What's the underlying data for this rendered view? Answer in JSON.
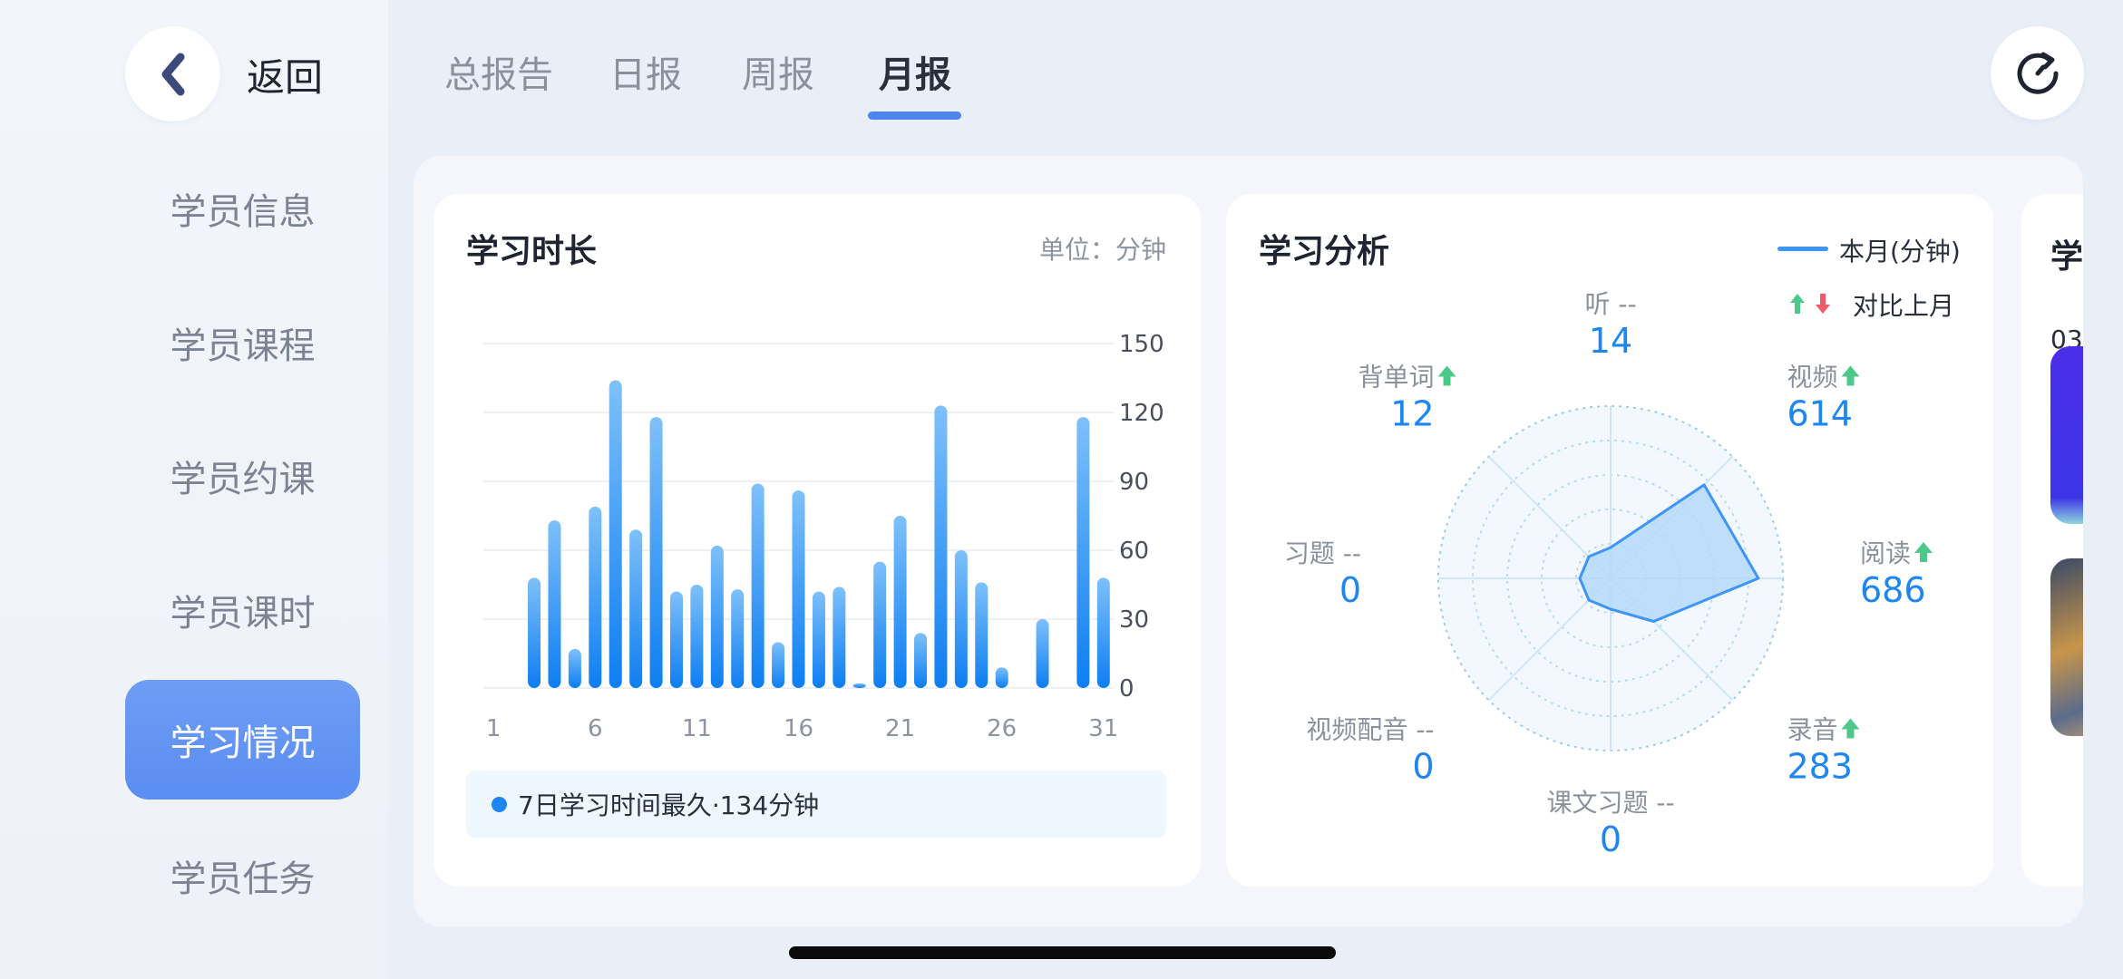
{
  "sidebar": {
    "back_label": "返回",
    "items": [
      {
        "label": "学员信息"
      },
      {
        "label": "学员课程"
      },
      {
        "label": "学员约课"
      },
      {
        "label": "学员课时"
      },
      {
        "label": "学习情况"
      },
      {
        "label": "学员任务"
      }
    ],
    "active_index": 4
  },
  "tabs": [
    {
      "label": "总报告"
    },
    {
      "label": "日报"
    },
    {
      "label": "周报"
    },
    {
      "label": "月报"
    }
  ],
  "active_tab_index": 3,
  "study_time_card": {
    "title": "学习时长",
    "unit": "单位：分钟",
    "summary": "7日学习时间最久·134分钟"
  },
  "analysis_card": {
    "title": "学习分析",
    "legend_current": "本月(分钟)",
    "legend_compare": "对比上月",
    "dims": [
      {
        "name": "听",
        "trend": "--",
        "value": "14"
      },
      {
        "name": "视频",
        "trend": "up",
        "value": "614"
      },
      {
        "name": "阅读",
        "trend": "up",
        "value": "686"
      },
      {
        "name": "录音",
        "trend": "up",
        "value": "283"
      },
      {
        "name": "课文习题",
        "trend": "--",
        "value": "0"
      },
      {
        "name": "视频配音",
        "trend": "--",
        "value": "0"
      },
      {
        "name": "习题",
        "trend": "--",
        "value": "0"
      },
      {
        "name": "背单词",
        "trend": "up",
        "value": "12"
      }
    ]
  },
  "third_card": {
    "title": "学",
    "sub": "03"
  },
  "colors": {
    "accent": "#4E86F0",
    "bar": "#1E86F2",
    "up_arrow": "#4CC98A",
    "down_arrow": "#F2596B",
    "radar_fill": "#B5D9F8",
    "radar_stroke": "#3E95F5"
  },
  "icons": {
    "back": "chevron-left-icon",
    "refresh": "refresh-icon",
    "trend_up": "arrow-up-icon",
    "trend_down": "arrow-down-icon"
  },
  "chart_data": [
    {
      "type": "bar",
      "title": "学习时长",
      "xlabel": "",
      "ylabel": "单位：分钟",
      "ylim": [
        0,
        150
      ],
      "yticks": [
        0,
        30,
        60,
        90,
        120,
        150
      ],
      "xticks": [
        1,
        6,
        11,
        16,
        21,
        26,
        31
      ],
      "grid": true,
      "x": [
        1,
        2,
        3,
        4,
        5,
        6,
        7,
        8,
        9,
        10,
        11,
        12,
        13,
        14,
        15,
        16,
        17,
        18,
        19,
        20,
        21,
        22,
        23,
        24,
        25,
        26,
        27,
        28,
        29,
        30,
        31
      ],
      "values": [
        0,
        0,
        48,
        73,
        17,
        79,
        134,
        69,
        118,
        42,
        45,
        62,
        43,
        89,
        20,
        86,
        42,
        44,
        2,
        55,
        75,
        24,
        123,
        60,
        46,
        9,
        0,
        30,
        0,
        118,
        48
      ]
    },
    {
      "type": "radar",
      "title": "学习分析",
      "series": [
        {
          "name": "本月(分钟)",
          "values": [
            14,
            614,
            686,
            283,
            0,
            0,
            0,
            12
          ]
        }
      ],
      "categories": [
        "听",
        "视频",
        "阅读",
        "录音",
        "课文习题",
        "视频配音",
        "习题",
        "背单词"
      ],
      "rmax": 800,
      "legend": "top-right"
    }
  ]
}
